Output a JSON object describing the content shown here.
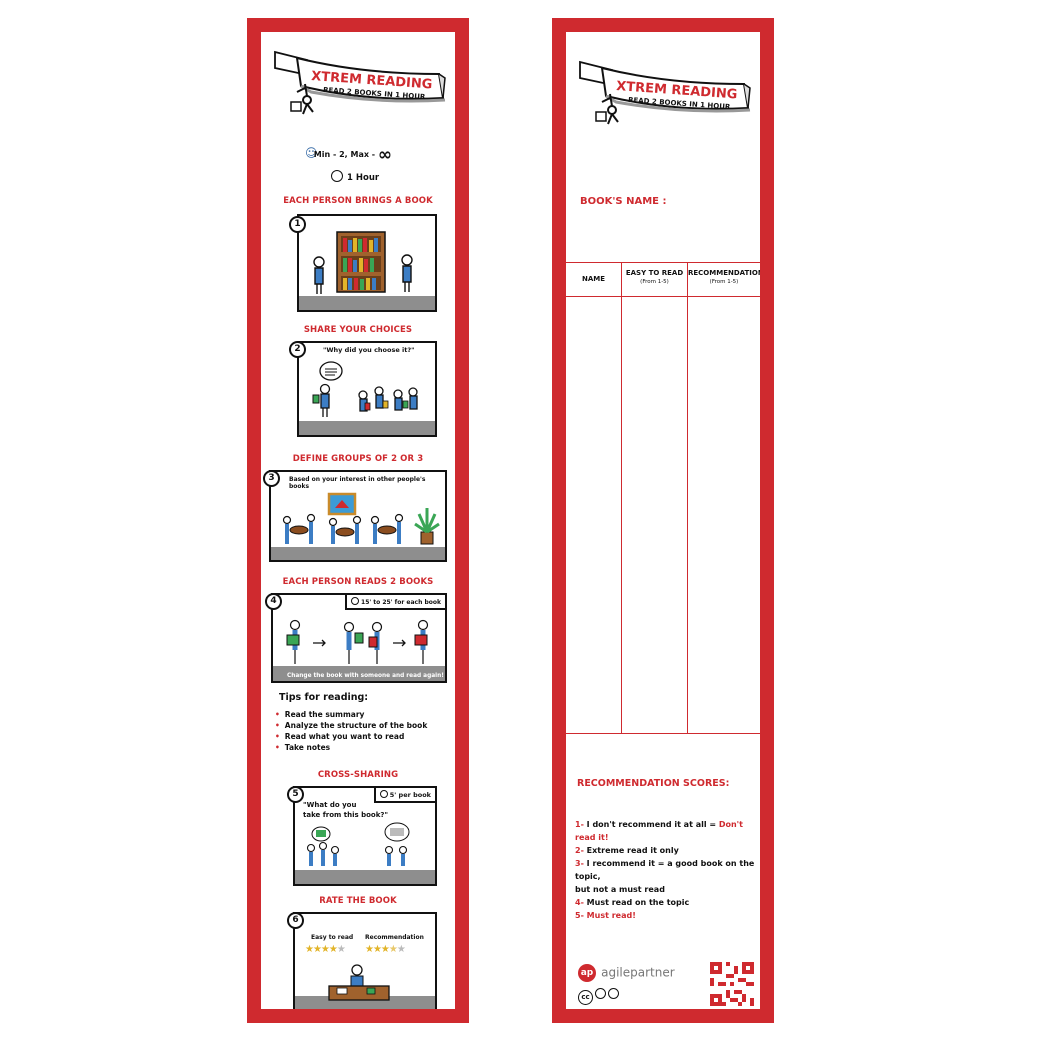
{
  "banner": {
    "title": "XTREM READING",
    "subtitle": "READ 2 BOOKS IN 1 HOUR"
  },
  "info": {
    "players": "Min - 2, Max -",
    "infinity": "∞",
    "duration": "1 Hour"
  },
  "steps": [
    {
      "number": "1",
      "title": "EACH PERSON BRINGS A BOOK"
    },
    {
      "number": "2",
      "title": "SHARE YOUR CHOICES",
      "quote": "\"Why did you choose it?\""
    },
    {
      "number": "3",
      "title": "DEFINE GROUPS OF 2 OR 3",
      "caption": "Based on your interest in other people's books"
    },
    {
      "number": "4",
      "title": "EACH PERSON READS 2 BOOKS",
      "timer": "15' to 25' for each book",
      "caption": "Change the book with someone and read again!"
    },
    {
      "number": "5",
      "title": "CROSS-SHARING",
      "timer": "5' per book",
      "quote_line1": "\"What do you",
      "quote_line2": "take from this book?\""
    },
    {
      "number": "6",
      "title": "RATE THE BOOK",
      "label_easy": "Easy to read",
      "label_rec": "Recommendation",
      "easy_stars": 4,
      "rec_stars": 3.5
    }
  ],
  "tips": {
    "title": "Tips for reading:",
    "items": [
      "Read the summary",
      "Analyze the structure of the book",
      "Read what you want to read",
      "Take notes"
    ]
  },
  "form": {
    "book_name_label": "BOOK'S NAME :",
    "col_name": "NAME",
    "col_easy": "EASY TO READ",
    "col_easy_sub": "(From 1-5)",
    "col_rec": "RECOMMENDATION",
    "col_rec_sub": "(From 1-5)",
    "scores_title": "RECOMMENDATION SCORES:",
    "scores": [
      {
        "num": "1-",
        "text": " I don't recommend it at all = ",
        "emph": "Don't read it!"
      },
      {
        "num": "2-",
        "text": " Extreme read it only",
        "emph": ""
      },
      {
        "num": "3-",
        "text": " I recommend it = a good book on the topic,",
        "emph": ""
      },
      {
        "num": "",
        "text": "but not a must read",
        "emph": ""
      },
      {
        "num": "4-",
        "text": " Must read on the topic",
        "emph": ""
      },
      {
        "num": "5-",
        "text": "",
        "emph": " Must read!"
      }
    ],
    "brand_logo": "ap",
    "brand_name": "agilepartner",
    "license": "cc"
  },
  "colors": {
    "accent": "#cf2a2f",
    "floor": "#8e8e8e",
    "star": "#e2b429"
  }
}
